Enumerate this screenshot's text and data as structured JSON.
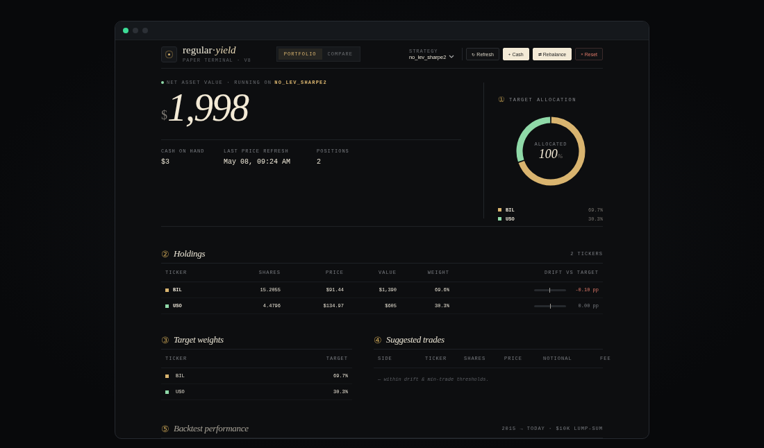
{
  "window": {
    "traffic_lights": [
      {
        "color": "#3ddc97"
      },
      {
        "color": "#2c3036"
      },
      {
        "color": "#2c3036"
      }
    ]
  },
  "header": {
    "brand": {
      "name": "regular·",
      "name_italic": "yield",
      "subtitle": "PAPER TERMINAL · V8"
    },
    "tabs": [
      {
        "label": "PORTFOLIO",
        "selected": true
      },
      {
        "label": "COMPARE",
        "selected": false
      }
    ],
    "strategy": {
      "label": "STRATEGY",
      "value": "no_lev_sharpe2"
    },
    "buttons": [
      {
        "icon": "↻",
        "label": "Refresh",
        "kind": "ghost"
      },
      {
        "icon": "+",
        "label": "Cash",
        "kind": "light"
      },
      {
        "icon": "⇄",
        "label": "Rebalance",
        "kind": "light"
      },
      {
        "icon": "×",
        "label": "Reset",
        "kind": "danger"
      }
    ]
  },
  "nav": {
    "label": "NET ASSET VALUE · RUNNING ON",
    "strategy": "NO_LEV_SHARPE2",
    "currency": "$",
    "value": "1,998",
    "stats": [
      {
        "label": "CASH ON HAND",
        "value": "$3"
      },
      {
        "label": "LAST PRICE REFRESH",
        "value": "May 08, 09:24 AM"
      },
      {
        "label": "POSITIONS",
        "value": "2"
      }
    ]
  },
  "allocation": {
    "number": "①",
    "title": "TARGET ALLOCATION",
    "center_label": "ALLOCATED",
    "center_value": "100",
    "center_unit": "%",
    "legend": [
      {
        "ticker": "BIL",
        "value": "69.7%",
        "color": "#d9b46f"
      },
      {
        "ticker": "USO",
        "value": "30.3%",
        "color": "#8fd9a8"
      }
    ]
  },
  "holdings": {
    "number": "②",
    "title": "Holdings",
    "count": "2 TICKERS",
    "columns": [
      "TICKER",
      "SHARES",
      "PRICE",
      "VALUE",
      "WEIGHT",
      "DRIFT VS TARGET"
    ],
    "rows": [
      {
        "ticker": "BIL",
        "color": "#d9b46f",
        "shares": "15.2055",
        "price": "$91.44",
        "value": "$1,390",
        "weight": "69.6%",
        "level": 0.47,
        "drift": "-0.10 pp",
        "negative": true
      },
      {
        "ticker": "USO",
        "color": "#8fd9a8",
        "shares": "4.4796",
        "price": "$134.97",
        "value": "$605",
        "weight": "30.3%",
        "level": 0.5,
        "drift": "0.00 pp",
        "negative": false
      }
    ]
  },
  "target_weights": {
    "number": "③",
    "title": "Target weights",
    "columns": [
      "TICKER",
      "TARGET"
    ],
    "rows": [
      {
        "ticker": "BIL",
        "color": "#d9b46f",
        "target": "69.7%"
      },
      {
        "ticker": "USO",
        "color": "#8fd9a8",
        "target": "30.3%"
      }
    ]
  },
  "suggested_trades": {
    "number": "④",
    "title": "Suggested trades",
    "columns": [
      "SIDE",
      "TICKER",
      "SHARES",
      "PRICE",
      "NOTIONAL",
      "FEE"
    ],
    "empty_message": "— within drift & min-trade thresholds."
  },
  "backtest": {
    "number": "⑤",
    "title": "Backtest performance",
    "note": "2015 → TODAY · $10K LUMP-SUM"
  }
}
